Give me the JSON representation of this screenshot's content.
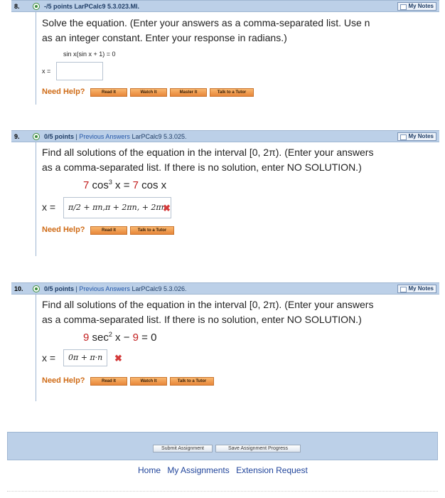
{
  "q8": {
    "num": "8.",
    "info": "-/5 points  LarPCalc9 5.3.023.MI.",
    "notes": "My Notes",
    "prompt_lines": [
      "Solve the equation. (Enter your answers as a comma-separated list. Use n",
      "as an integer constant. Enter your response in radians.)"
    ],
    "equation": "sin x(sin x + 1) = 0",
    "x_label": "x =",
    "answer": "",
    "need_help": "Need Help?",
    "buttons": [
      "Read It",
      "Watch It",
      "Master It",
      "Talk to a Tutor"
    ]
  },
  "q9": {
    "num": "9.",
    "points": "0/5 points",
    "sep": "|",
    "prev": "Previous Answers",
    "src": "LarPCalc9 5.3.025.",
    "notes": "My Notes",
    "prompt_lines": [
      "Find all solutions of the equation in the interval [0, 2π). (Enter your answers",
      "as a comma-separated list. If there is no solution, enter NO SOLUTION.)"
    ],
    "eq_a": "7",
    "eq_b": " cos",
    "eq_sup": "3",
    "eq_c": " x = ",
    "eq_d": "7",
    "eq_e": " cos x",
    "x_label": "x =",
    "answer": "π/2 + πn,π + 2πn, + 2πn",
    "need_help": "Need Help?",
    "buttons": [
      "Read It",
      "Talk to a Tutor"
    ]
  },
  "q10": {
    "num": "10.",
    "points": "0/5 points",
    "sep": "|",
    "prev": "Previous Answers",
    "src": "LarPCalc9 5.3.026.",
    "notes": "My Notes",
    "prompt_lines": [
      "Find all solutions of the equation in the interval [0, 2π). (Enter your answers",
      "as a comma-separated list. If there is no solution, enter NO SOLUTION.)"
    ],
    "eq_a": "9",
    "eq_b": " sec",
    "eq_sup": "2",
    "eq_c": " x − ",
    "eq_d": "9",
    "eq_e": " = 0",
    "x_label": "x =",
    "answer": "0π + π·n",
    "need_help": "Need Help?",
    "buttons": [
      "Read It",
      "Watch It",
      "Talk to a Tutor"
    ]
  },
  "footer": {
    "submit": "Submit Assignment",
    "save": "Save Assignment Progress"
  },
  "nav": [
    "Home",
    "My Assignments",
    "Extension Request"
  ],
  "colors": {
    "header_bg": "#bcd0e8",
    "need_help": "#cf6b16",
    "highlight_red": "#c21e1e",
    "link_blue": "#21459b"
  }
}
